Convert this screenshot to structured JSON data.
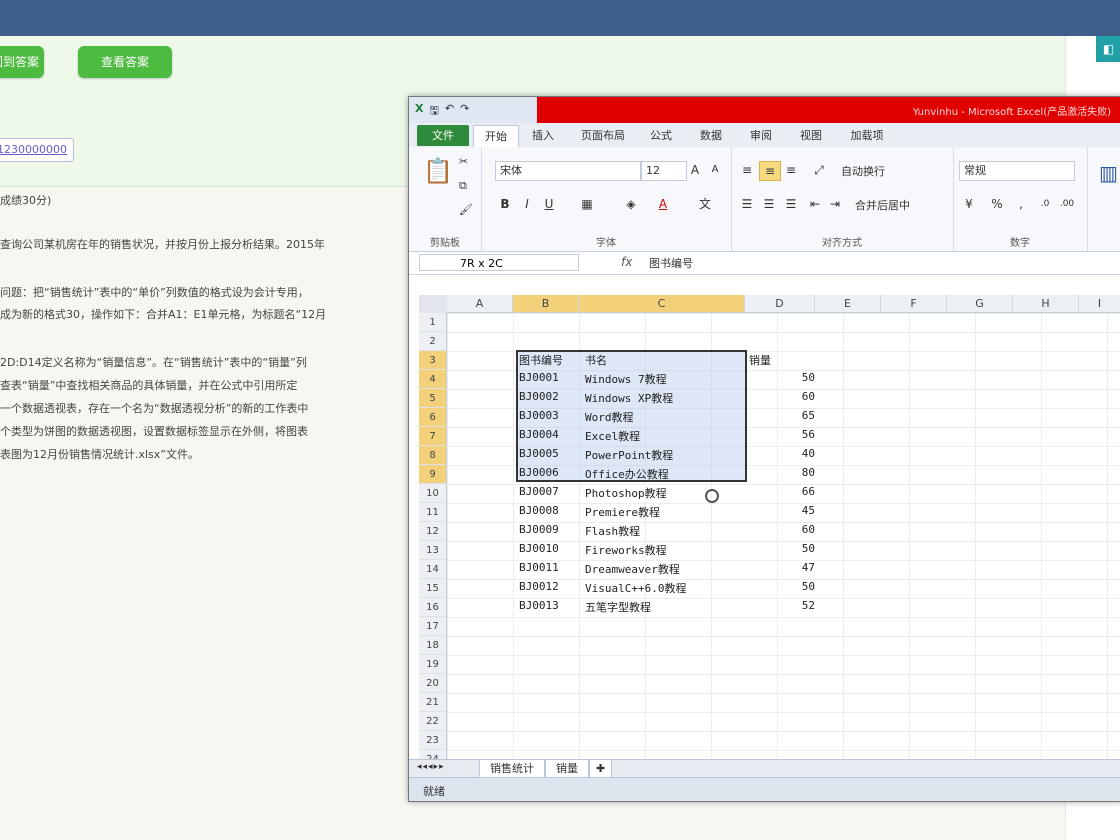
{
  "page": {
    "buttons": [
      "回到答案",
      "查看答案"
    ],
    "link_text": "1230000000",
    "question_lines": [
      "成绩30分)",
      "查询公司某机房在年的销售状况，并按月份上报分析结果。2015年",
      "问题：把“销售统计”表中的“单价”列数值的格式设为会计专用，",
      "成为新的格式30，操作如下：合并A1：E1单元格，为标题名“12月",
      "2D:D14定义名称为“销量信息”。在“销售统计”表中的“销量”列",
      "查表“销量”中查找相关商品的具体销量，并在公式中引用所定",
      "一个数据透视表，存在一个名为“数据透视分析”的新的工作表中",
      "个类型为饼图的数据透视图，设置数据标签显示在外侧，将图表",
      "表图为12月份销售情况统计.xlsx”文件。"
    ]
  },
  "excel": {
    "title": "Yunvinhu - Microsoft Excel(产品激活失败)",
    "ribbon_tabs": [
      "文件",
      "开始",
      "插入",
      "页面布局",
      "公式",
      "数据",
      "审阅",
      "视图",
      "加载项"
    ],
    "ribbon": {
      "font_name": "宋体",
      "font_size": "12",
      "wrap_text": "自动换行",
      "number_format": "常规",
      "merge_center": "合并后居中",
      "groups": [
        "剪贴板",
        "字体",
        "对齐方式",
        "数字"
      ]
    },
    "name_box": "7R x 2C",
    "formula": "图书编号",
    "columns": [
      "A",
      "B",
      "C",
      "D",
      "E",
      "F",
      "G",
      "H",
      "I"
    ],
    "headers": {
      "b": "图书编号",
      "c": "书名",
      "d": "销量"
    },
    "rows": [
      {
        "id": "BJ0001",
        "name": "Windows 7教程",
        "qty": "50"
      },
      {
        "id": "BJ0002",
        "name": "Windows XP教程",
        "qty": "60"
      },
      {
        "id": "BJ0003",
        "name": "Word教程",
        "qty": "65"
      },
      {
        "id": "BJ0004",
        "name": "Excel教程",
        "qty": "56"
      },
      {
        "id": "BJ0005",
        "name": "PowerPoint教程",
        "qty": "40"
      },
      {
        "id": "BJ0006",
        "name": "Office办公教程",
        "qty": "80"
      },
      {
        "id": "BJ0007",
        "name": "Photoshop教程",
        "qty": "66"
      },
      {
        "id": "BJ0008",
        "name": "Premiere教程",
        "qty": "45"
      },
      {
        "id": "BJ0009",
        "name": "Flash教程",
        "qty": "60"
      },
      {
        "id": "BJ0010",
        "name": "Fireworks教程",
        "qty": "50"
      },
      {
        "id": "BJ0011",
        "name": "Dreamweaver教程",
        "qty": "47"
      },
      {
        "id": "BJ0012",
        "name": "VisualC++6.0教程",
        "qty": "50"
      },
      {
        "id": "BJ0013",
        "name": "五笔字型教程",
        "qty": "52"
      }
    ],
    "sheet_tabs": [
      "销售统计",
      "销量"
    ],
    "status": "就绪"
  },
  "colors": {
    "title_red": "#e00000",
    "file_tab": "#2f8a3c",
    "selection_header": "#f3d17a",
    "page_green": "#4dbb3f"
  }
}
